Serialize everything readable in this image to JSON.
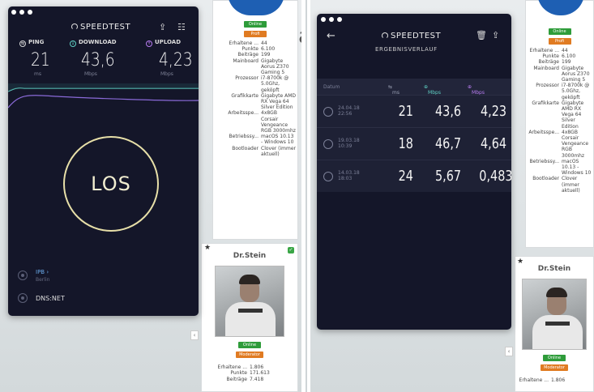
{
  "left_window": {
    "title": "SPEEDTEST",
    "share_icon": "share-icon",
    "settings_icon": "sliders-icon",
    "metrics": [
      {
        "label": "PING",
        "value": "21",
        "unit": "ms",
        "color": "#d7d7d7"
      },
      {
        "label": "DOWNLOAD",
        "value": "43,6",
        "unit": "Mbps",
        "color": "#5fd0c4"
      },
      {
        "label": "UPLOAD",
        "value": "4,23",
        "unit": "Mbps",
        "color": "#b77cf0"
      }
    ],
    "go_button": "LOS",
    "isp_name": "IPB ›",
    "isp_location": "Berlin",
    "server": "DNS:NET"
  },
  "right_window": {
    "title": "SPEEDTEST",
    "subtitle": "ERGEBNISVERLAUF",
    "columns": {
      "date": "Datum",
      "ping": "ms",
      "download": "Mbps",
      "upload": "Mbps"
    },
    "rows": [
      {
        "date": "24.04.18",
        "time": "22:56",
        "ping": "21",
        "download": "43,6",
        "upload": "4,23"
      },
      {
        "date": "19.03.18",
        "time": "10:39",
        "ping": "18",
        "download": "46,7",
        "upload": "4,64"
      },
      {
        "date": "14.03.18",
        "time": "18:03",
        "ping": "24",
        "download": "5,67",
        "upload": "0,483"
      }
    ]
  },
  "forum_left": {
    "status": "Online",
    "rank": "Profi",
    "props": [
      [
        "Erhaltene ...",
        "44"
      ],
      [
        "Punkte",
        "6.100"
      ],
      [
        "Beiträge",
        "199"
      ],
      [
        "Mainboard",
        "Gigabyte Aorus Z370 Gaming 5"
      ],
      [
        "Prozessor",
        "i7-8700k @ 5.0Ghz, geköpft"
      ],
      [
        "Grafikkarte",
        "Gigabyte AMD RX Vega 64 Silver Edition"
      ],
      [
        "Arbeitsspe...",
        "4x8GB Corsair Vengeance RGB 3000mhz"
      ],
      [
        "Betriebssy...",
        "macOS 10.13 - Windows 10"
      ],
      [
        "Bootloader",
        "Clover (immer aktuell)"
      ]
    ],
    "user2": {
      "name": "Dr.Stein",
      "status": "Online",
      "rank": "Moderator",
      "props": [
        [
          "Erhaltene ...",
          "1.806"
        ],
        [
          "Punkte",
          "171.613"
        ],
        [
          "Beiträge",
          "7.418"
        ]
      ]
    }
  },
  "forum_right": {
    "status": "Online",
    "rank": "Profi",
    "props": [
      [
        "Erhaltene ...",
        "44"
      ],
      [
        "Punkte",
        "6.100"
      ],
      [
        "Beiträge",
        "199"
      ],
      [
        "Mainboard",
        "Gigabyte Aorus Z370 Gaming 5"
      ],
      [
        "Prozessor",
        "i7-8700k @ 5.0Ghz, geköpft"
      ],
      [
        "Grafikkarte",
        "Gigabyte AMD RX Vega 64 Silver Edition"
      ],
      [
        "Arbeitsspe...",
        "4x8GB Corsair Vengeance RGB 3000mhz"
      ],
      [
        "Betriebssy...",
        "macOS 10.13 - Windows 10"
      ],
      [
        "Bootloader",
        "Clover (immer aktuell)"
      ]
    ],
    "user2": {
      "name": "Dr.Stein",
      "status": "Online",
      "rank": "Moderator",
      "props": [
        [
          "Erhaltene ...",
          "1.806"
        ]
      ]
    }
  },
  "ghost_text": [
    "a",
    "t"
  ]
}
